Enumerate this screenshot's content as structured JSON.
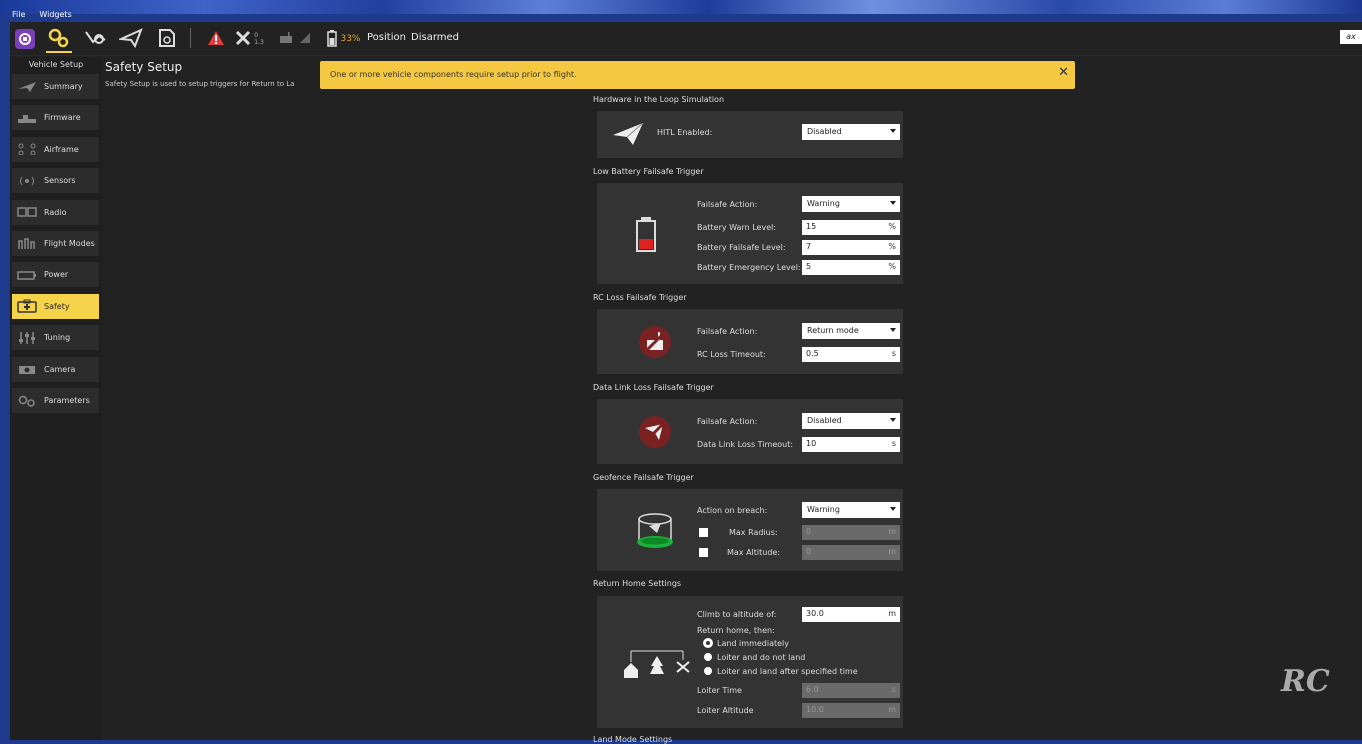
{
  "menu": {
    "file": "File",
    "widgets": "Widgets"
  },
  "toolbar": {
    "battery_pct": "33%",
    "position": "Position",
    "armed": "Disarmed",
    "gps_count": "0",
    "gps_hdop": "1.3"
  },
  "sidebar": {
    "title": "Vehicle Setup",
    "items": [
      {
        "label": "Summary",
        "icon": "plane-icon"
      },
      {
        "label": "Firmware",
        "icon": "firmware-icon"
      },
      {
        "label": "Airframe",
        "icon": "airframe-icon"
      },
      {
        "label": "Sensors",
        "icon": "sensors-icon"
      },
      {
        "label": "Radio",
        "icon": "radio-icon"
      },
      {
        "label": "Flight Modes",
        "icon": "flight-modes-icon"
      },
      {
        "label": "Power",
        "icon": "power-icon"
      },
      {
        "label": "Safety",
        "icon": "safety-icon",
        "active": true
      },
      {
        "label": "Tuning",
        "icon": "tuning-icon"
      },
      {
        "label": "Camera",
        "icon": "camera-icon"
      },
      {
        "label": "Parameters",
        "icon": "parameters-icon"
      }
    ]
  },
  "page": {
    "title": "Safety Setup",
    "description": "Safety Setup is used to setup triggers for Return to La"
  },
  "banner": {
    "text": "One or more vehicle components require setup prior to flight.",
    "close": "✕"
  },
  "hitl": {
    "section": "Hardware in the Loop Simulation",
    "label": "HITL Enabled:",
    "value": "Disabled"
  },
  "battery": {
    "section": "Low Battery Failsafe Trigger",
    "action_label": "Failsafe Action:",
    "action_value": "Warning",
    "warn_label": "Battery Warn Level:",
    "warn_value": "15",
    "failsafe_label": "Battery Failsafe Level:",
    "failsafe_value": "7",
    "emergency_label": "Battery Emergency Level:",
    "emergency_value": "5",
    "unit": "%"
  },
  "rc": {
    "section": "RC Loss Failsafe Trigger",
    "action_label": "Failsafe Action:",
    "action_value": "Return mode",
    "timeout_label": "RC Loss Timeout:",
    "timeout_value": "0.5",
    "unit": "s"
  },
  "datalink": {
    "section": "Data Link Loss Failsafe Trigger",
    "action_label": "Failsafe Action:",
    "action_value": "Disabled",
    "timeout_label": "Data Link Loss Timeout:",
    "timeout_value": "10",
    "unit": "s"
  },
  "geofence": {
    "section": "Geofence Failsafe Trigger",
    "action_label": "Action on breach:",
    "action_value": "Warning",
    "radius_label": "Max Radius:",
    "radius_value": "0",
    "radius_unit": "m",
    "alt_label": "Max Altitude:",
    "alt_value": "0",
    "alt_unit": "m"
  },
  "rth": {
    "section": "Return Home Settings",
    "climb_label": "Climb to altitude of:",
    "climb_value": "30.0",
    "climb_unit": "m",
    "then_label": "Return home, then:",
    "opt1": "Land immediately",
    "opt2": "Loiter and do not land",
    "opt3": "Loiter and land after specified time",
    "loiter_time_label": "Loiter Time",
    "loiter_time_value": "6.0",
    "loiter_time_unit": "s",
    "loiter_alt_label": "Loiter Altitude",
    "loiter_alt_value": "10.0",
    "loiter_alt_unit": "m"
  },
  "next_section": "Land Mode Settings",
  "watermark": "RC",
  "logo": "ax"
}
